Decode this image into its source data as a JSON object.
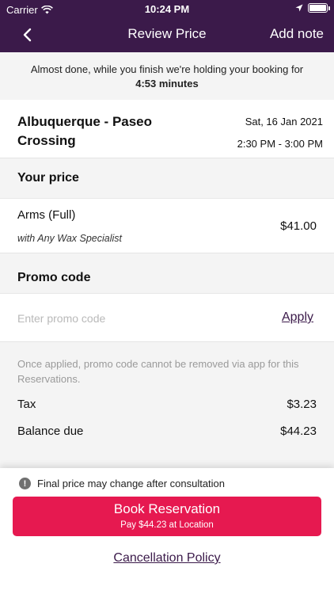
{
  "status_bar": {
    "carrier": "Carrier",
    "time": "10:24 PM"
  },
  "nav": {
    "title": "Review Price",
    "add_note": "Add note"
  },
  "hold": {
    "message": "Almost done, while you finish we're holding your booking for",
    "timer": "4:53 minutes"
  },
  "location": {
    "name": "Albuquerque - Paseo Crossing",
    "date": "Sat, 16 Jan 2021",
    "time_range": "2:30 PM - 3:00 PM"
  },
  "your_price": {
    "heading": "Your price",
    "service": "Arms (Full)",
    "specialist": "with Any Wax Specialist",
    "amount": "$41.00"
  },
  "promo": {
    "heading": "Promo code",
    "placeholder": "Enter promo code",
    "apply_label": "Apply",
    "note": "Once applied, promo code cannot be removed via app for this Reservations."
  },
  "totals": {
    "tax_label": "Tax",
    "tax_value": "$3.23",
    "balance_label": "Balance due",
    "balance_value": "$44.23"
  },
  "footer": {
    "disclaimer": "Final price may change after consultation",
    "book_label": "Book Reservation",
    "book_sub": "Pay $44.23 at Location",
    "cancellation": "Cancellation Policy"
  },
  "colors": {
    "header_bg": "#3b1a4a",
    "accent": "#e61950"
  },
  "icons": {
    "back": "chevron-left-icon",
    "wifi": "wifi-icon",
    "location": "location-arrow-icon",
    "battery": "battery-icon",
    "info": "info-icon"
  }
}
